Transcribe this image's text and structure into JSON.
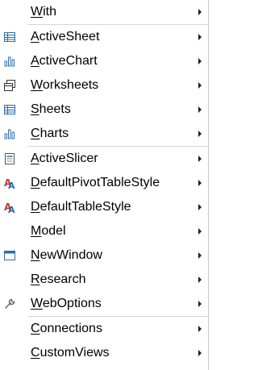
{
  "menu": {
    "items": [
      {
        "before": "",
        "u": "W",
        "after": "ith",
        "icon": ""
      },
      {
        "sep": true
      },
      {
        "before": "",
        "u": "A",
        "after": "ctiveSheet",
        "icon": "sheet-grid-icon"
      },
      {
        "before": "",
        "u": "A",
        "after": "ctiveChart",
        "icon": "bar-chart-icon"
      },
      {
        "before": "",
        "u": "W",
        "after": "orksheets",
        "icon": "worksheets-icon"
      },
      {
        "before": "",
        "u": "S",
        "after": "heets",
        "icon": "sheet-grid-icon"
      },
      {
        "before": "",
        "u": "C",
        "after": "harts",
        "icon": "bar-chart-icon"
      },
      {
        "sep": true
      },
      {
        "before": "",
        "u": "A",
        "after": "ctiveSlicer",
        "icon": "slicer-icon"
      },
      {
        "before": "",
        "u": "D",
        "after": "efaultPivotTableStyle",
        "icon": "table-style-icon"
      },
      {
        "before": "",
        "u": "D",
        "after": "efaultTableStyle",
        "icon": "table-style-icon"
      },
      {
        "before": "",
        "u": "M",
        "after": "odel",
        "icon": ""
      },
      {
        "before": "",
        "u": "N",
        "after": "ewWindow",
        "icon": "window-icon"
      },
      {
        "before": "",
        "u": "R",
        "after": "esearch",
        "icon": ""
      },
      {
        "before": "",
        "u": "W",
        "after": "ebOptions",
        "icon": "wrench-icon"
      },
      {
        "sep": true
      },
      {
        "before": "",
        "u": "C",
        "after": "onnections",
        "icon": ""
      },
      {
        "before": "",
        "u": "C",
        "after": "ustomViews",
        "icon": ""
      }
    ]
  },
  "colors": {
    "text": "#000000",
    "icon_blue": "#2b6cb0",
    "icon_red": "#c0392b",
    "separator": "#d4d4d4"
  }
}
